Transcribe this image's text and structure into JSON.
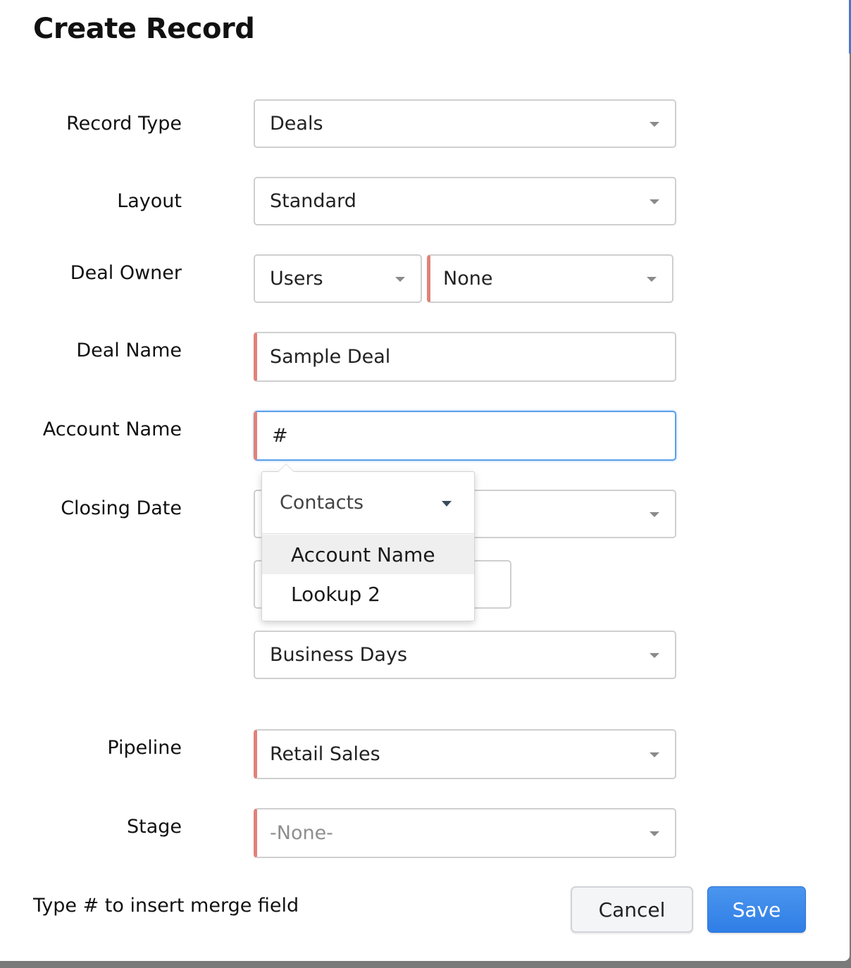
{
  "dialog": {
    "title": "Create Record"
  },
  "form": {
    "record_type": {
      "label": "Record Type",
      "value": "Deals"
    },
    "layout": {
      "label": "Layout",
      "value": "Standard"
    },
    "deal_owner": {
      "label": "Deal Owner",
      "type_value": "Users",
      "value": "None"
    },
    "deal_name": {
      "label": "Deal Name",
      "value": "Sample Deal"
    },
    "account_name": {
      "label": "Account Name",
      "value": "#"
    },
    "closing_date": {
      "label": "Closing Date",
      "value": "",
      "offset_value": "",
      "unit_value": "Business Days"
    },
    "pipeline": {
      "label": "Pipeline",
      "value": "Retail Sales"
    },
    "stage": {
      "label": "Stage",
      "value": "-None-"
    }
  },
  "merge_popup": {
    "module": "Contacts",
    "items": [
      {
        "label": "Account Name",
        "active": true
      },
      {
        "label": "Lookup 2",
        "active": false
      }
    ]
  },
  "footer": {
    "hint": "Type # to insert merge field",
    "cancel_label": "Cancel",
    "save_label": "Save"
  },
  "colors": {
    "required_marker": "#e0827a",
    "focus_border": "#5aa0ea",
    "save_button": "#2f7ee6"
  }
}
